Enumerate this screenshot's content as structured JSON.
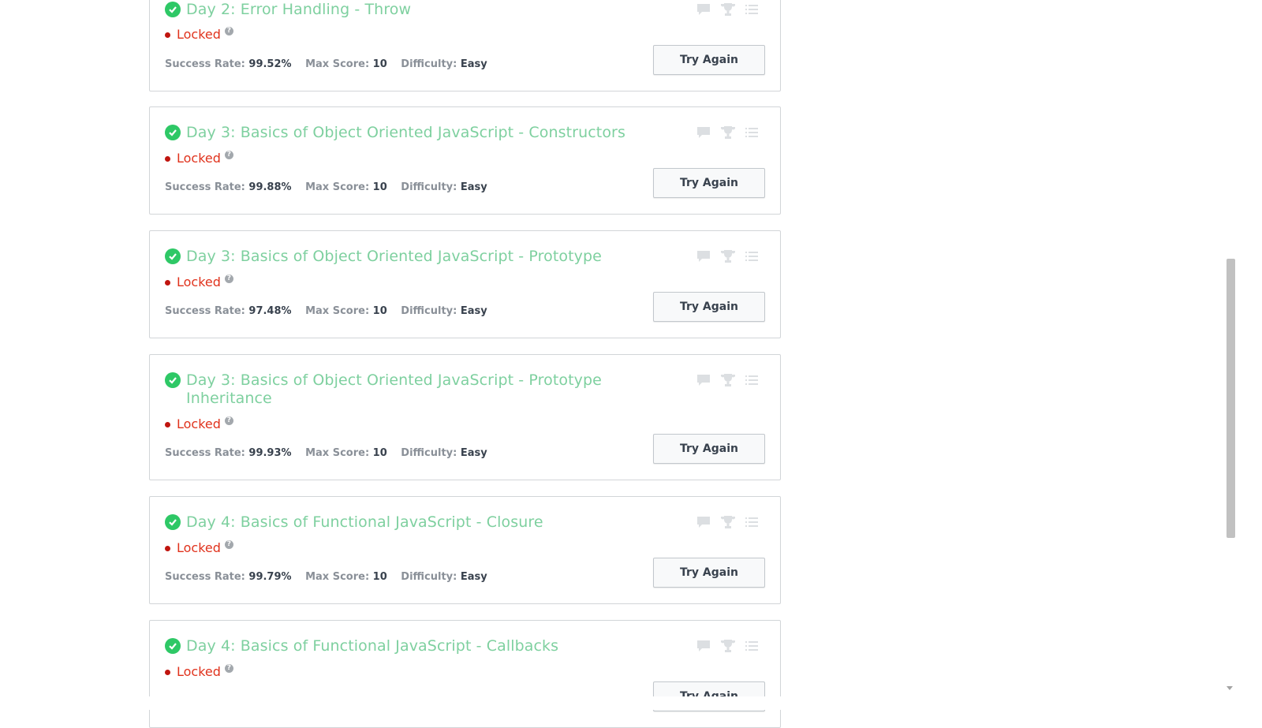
{
  "labels": {
    "success_rate": "Success Rate:",
    "max_score": "Max Score:",
    "difficulty": "Difficulty:"
  },
  "icons": {
    "discussion": "comment-icon",
    "leaderboard": "trophy-icon",
    "submissions": "list-icon",
    "solved": "check-circle-icon",
    "help": "question-icon"
  },
  "colors": {
    "title": "#7ed09f",
    "check": "#2ec866",
    "locked": "#e0321c",
    "icon_gray": "#dcdfe2"
  },
  "challenges": [
    {
      "title": "Day 2: Error Handling - Throw",
      "status": "Locked",
      "success_rate": "99.52%",
      "max_score": "10",
      "difficulty": "Easy",
      "button": "Try Again"
    },
    {
      "title": "Day 3: Basics of Object Oriented JavaScript - Constructors",
      "status": "Locked",
      "success_rate": "99.88%",
      "max_score": "10",
      "difficulty": "Easy",
      "button": "Try Again"
    },
    {
      "title": "Day 3: Basics of Object Oriented JavaScript - Prototype",
      "status": "Locked",
      "success_rate": "97.48%",
      "max_score": "10",
      "difficulty": "Easy",
      "button": "Try Again"
    },
    {
      "title": "Day 3: Basics of Object Oriented JavaScript - Prototype Inheritance",
      "status": "Locked",
      "success_rate": "99.93%",
      "max_score": "10",
      "difficulty": "Easy",
      "button": "Try Again"
    },
    {
      "title": "Day 4: Basics of Functional JavaScript - Closure",
      "status": "Locked",
      "success_rate": "99.79%",
      "max_score": "10",
      "difficulty": "Easy",
      "button": "Try Again"
    },
    {
      "title": "Day 4: Basics of Functional JavaScript - Callbacks",
      "status": "Locked",
      "success_rate": "",
      "max_score": "",
      "difficulty": "",
      "button": "Try Again"
    }
  ]
}
